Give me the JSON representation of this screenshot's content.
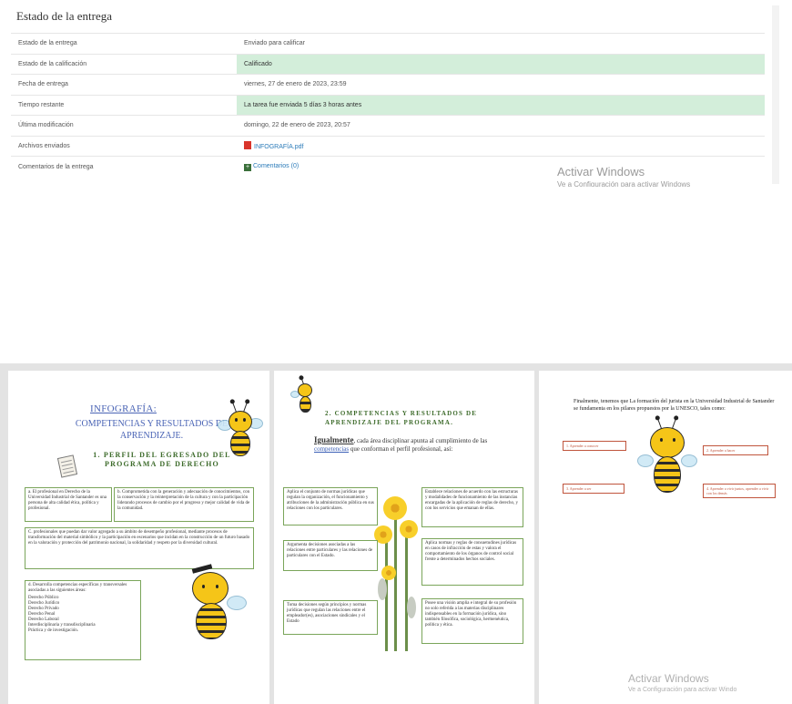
{
  "submission": {
    "title": "Estado de la entrega",
    "rows": [
      {
        "label": "Estado de la entrega",
        "value": "Enviado para calificar"
      },
      {
        "label": "Estado de la calificación",
        "value": "Calificado"
      },
      {
        "label": "Fecha de entrega",
        "value": "viernes, 27 de enero de 2023, 23:59"
      },
      {
        "label": "Tiempo restante",
        "value": "La tarea fue enviada 5 días 3 horas antes"
      },
      {
        "label": "Última modificación",
        "value": "domingo, 22 de enero de 2023, 20:57"
      },
      {
        "label": "Archivos enviados",
        "value": "INFOGRAFÍA.pdf"
      },
      {
        "label": "Comentarios de la entrega",
        "value": "Comentarios (0)"
      }
    ],
    "highlight_color": "#d3eeda",
    "file_icon": "pdf-file-icon",
    "comments_icon": "plus-expand-icon"
  },
  "watermark": {
    "line1": "Activar Windows",
    "line1_repeat": "Activar Windows",
    "line2": "Ve a Configuración para activar Windows",
    "line2_repeat": "Ve a Configuración para activar Windo"
  },
  "infographic": {
    "page1": {
      "title": "INFOGRAFÍA:",
      "subtitle": "COMPETENCIAS Y RESULTADOS DE APRENDIZAJE.",
      "section": "1. PERFIL DEL EGRESADO DEL PROGRAMA DE DERECHO",
      "boxes": [
        "a. El profesional en Derecho de la Universidad Industrial de Santander es una persona de alta calidad ética, política y profesional.",
        "b. Comprometida con la generación y adecuación de conocimientos, con la conservación y la reinterpretación de la cultura y con la participación liderando procesos de cambio por el progreso y mejor calidad de vida de la comunidad.",
        "C. profesionales que puedan dar valor agregado a su ámbito de desempeño profesional, mediante procesos de transformación del material simbólico y la participación en escenarios que incidan en la construcción de un futuro basado en la valoración y protección del patrimonio nacional, la solidaridad y respeto por la diversidad cultural.",
        "d. Desarrolla competencias específicas y transversales asociadas a las siguientes áreas:"
      ],
      "areas": [
        "Derecho Público",
        "Derecho Jurídico",
        "Derecho Privado",
        "Derecho Penal",
        "Derecho Laboral",
        "Interdisciplinaria y transdisciplinaria",
        "Práctica y de investigación."
      ]
    },
    "page2": {
      "section": "2. COMPETENCIAS Y RESULTADOS DE APRENDIZAJE DEL PROGRAMA.",
      "intro_lead": "Igualmente",
      "intro_a": ", cada área disciplinar apunta al cumplimiento de las ",
      "intro_link": "competencias",
      "intro_b": " que conforman el perfil profesional, así:",
      "boxes": [
        "Aplica el conjunto de normas jurídicas que regulan la organización, el funcionamiento y atribuciones de la administración pública en sus relaciones con los particulares.",
        "Establece relaciones de acuerdo con las estructuras y modalidades de funcionamiento de las instancias encargadas de la aplicación de reglas de derecho, y con los servicios que emanan de ellas.",
        "Argumenta decisiones asociadas a las relaciones entre particulares y las relaciones de particulares con el Estado.",
        "Aplica normas y reglas de consuetudines jurídicas en casos de infracción de estas y valora el comportamiento de los órganos de control social frente a determinados hechos sociales.",
        "Toma decisiones según principios y normas jurídicas que regulan las relaciones entre el empleador(es), asociaciones sindicales y el Estado",
        "Posee una visión amplia e integral de su profesión no solo referida a las materias disciplinares indispensables en la formación jurídica, sino también filosófica, sociológica, hermenéutica, política y ética."
      ]
    },
    "page3": {
      "intro": "Finalmente, tenemos que La formación del jurista en la Universidad Industrial de Santander se fundamenta en los pilares propuestos por la UNESCO, tales como:",
      "pillars": [
        "1. Aprender a conocer",
        "2. Aprender a hacer",
        "3. Aprender a ser",
        "4. Aprender a vivir juntos, aprender a vivir con los demás"
      ]
    }
  }
}
